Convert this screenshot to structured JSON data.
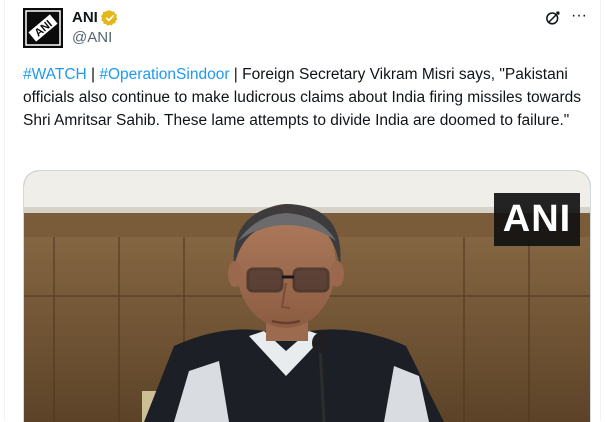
{
  "author": {
    "name": "ANI",
    "handle": "@ANI",
    "verified": true,
    "avatar_logo_text": "ANI"
  },
  "header_icons": [
    "grok-icon",
    "more-icon"
  ],
  "more_label": "···",
  "tweet": {
    "hashtag1": "#WATCH",
    "sep1": " | ",
    "hashtag2": "#OperationSindoor",
    "body": " | Foreign Secretary Vikram Misri says, \"Pakistani officials also continue to make ludicrous claims about India firing missiles towards Shri Amritsar Sahib. These lame attempts to divide India are doomed to failure.\""
  },
  "media": {
    "type": "video-still",
    "watermark": "ANI"
  },
  "colors": {
    "link": "#1d9bf0",
    "verified": "#e2b719",
    "secondary_text": "#536471"
  }
}
